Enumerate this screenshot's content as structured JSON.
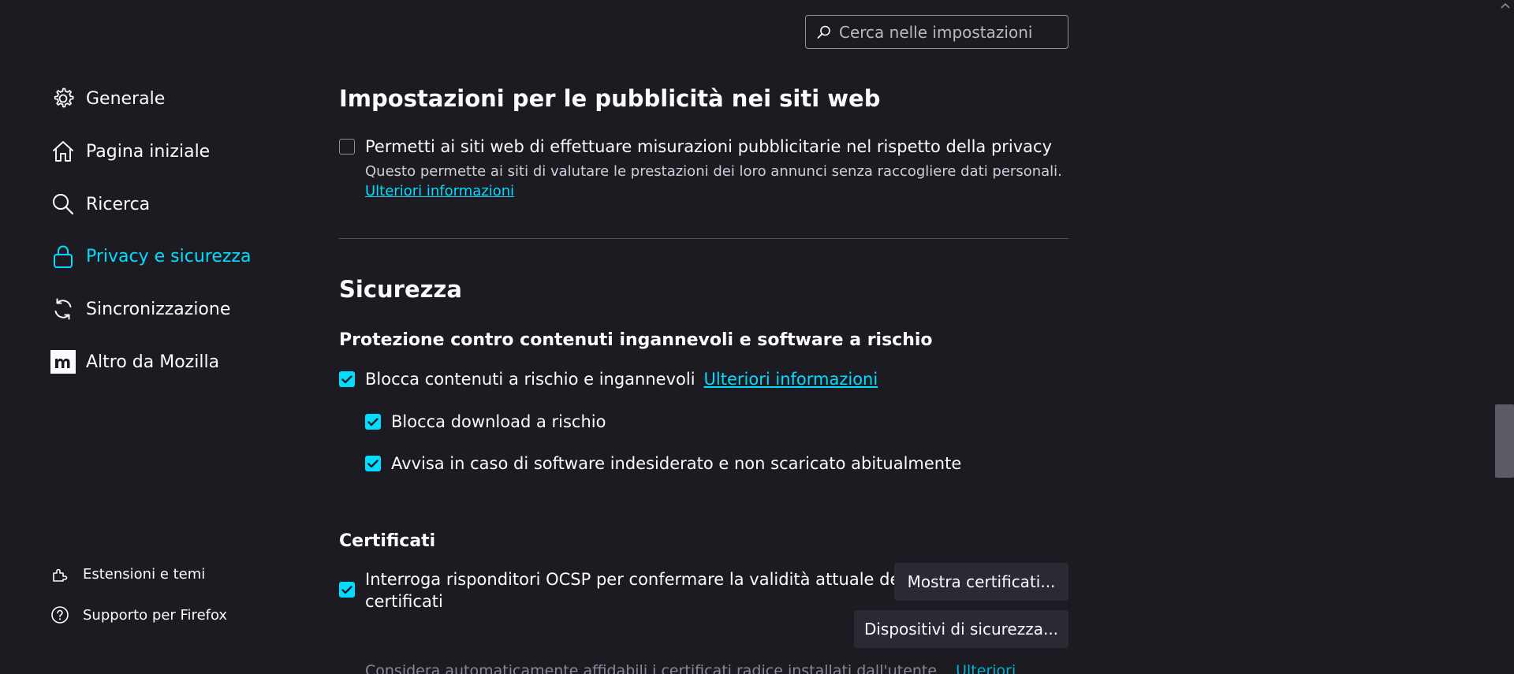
{
  "search": {
    "placeholder": "Cerca nelle impostazioni"
  },
  "sidebar": {
    "items": [
      {
        "label": "Generale",
        "icon": "gear-icon",
        "selected": false
      },
      {
        "label": "Pagina iniziale",
        "icon": "home-icon",
        "selected": false
      },
      {
        "label": "Ricerca",
        "icon": "search-icon",
        "selected": false
      },
      {
        "label": "Privacy e sicurezza",
        "icon": "lock-icon",
        "selected": true
      },
      {
        "label": "Sincronizzazione",
        "icon": "sync-icon",
        "selected": false
      },
      {
        "label": "Altro da Mozilla",
        "icon": "mozilla-icon",
        "selected": false
      }
    ],
    "footer": [
      {
        "label": "Estensioni e temi",
        "icon": "puzzle-icon"
      },
      {
        "label": "Supporto per Firefox",
        "icon": "help-icon"
      }
    ]
  },
  "ads": {
    "title": "Impostazioni per le pubblicità nei siti web",
    "checkbox_label": "Permetti ai siti web di effettuare misurazioni pubblicitarie nel rispetto della privacy",
    "checked": false,
    "description": "Questo permette ai siti di valutare le prestazioni dei loro annunci senza raccogliere dati personali.",
    "link": "Ulteriori informazioni"
  },
  "security": {
    "title": "Sicurezza",
    "protection_heading": "Protezione contro contenuti ingannevoli e software a rischio",
    "block_label": "Blocca contenuti a rischio e ingannevoli",
    "block_link": "Ulteriori informazioni",
    "block_download_label": "Blocca download a rischio",
    "warn_label": "Avvisa in caso di software indesiderato e non scaricato abitualmente"
  },
  "certificates": {
    "title": "Certificati",
    "ocsp_line1": "Interroga risponditori OCSP per confermare la validità attuale dei",
    "ocsp_line2": "certificati",
    "show_button": "Mostra certificati...",
    "devices_button": "Dispositivi di sicurezza...",
    "partial_text": "Considera automaticamente affidabili i certificati radice installati dall'utente",
    "partial_link": "Ulteriori"
  },
  "colors": {
    "background": "#1c1b22",
    "accent": "#00ddff",
    "text": "#fbfbfe",
    "button": "#2b2a33"
  }
}
